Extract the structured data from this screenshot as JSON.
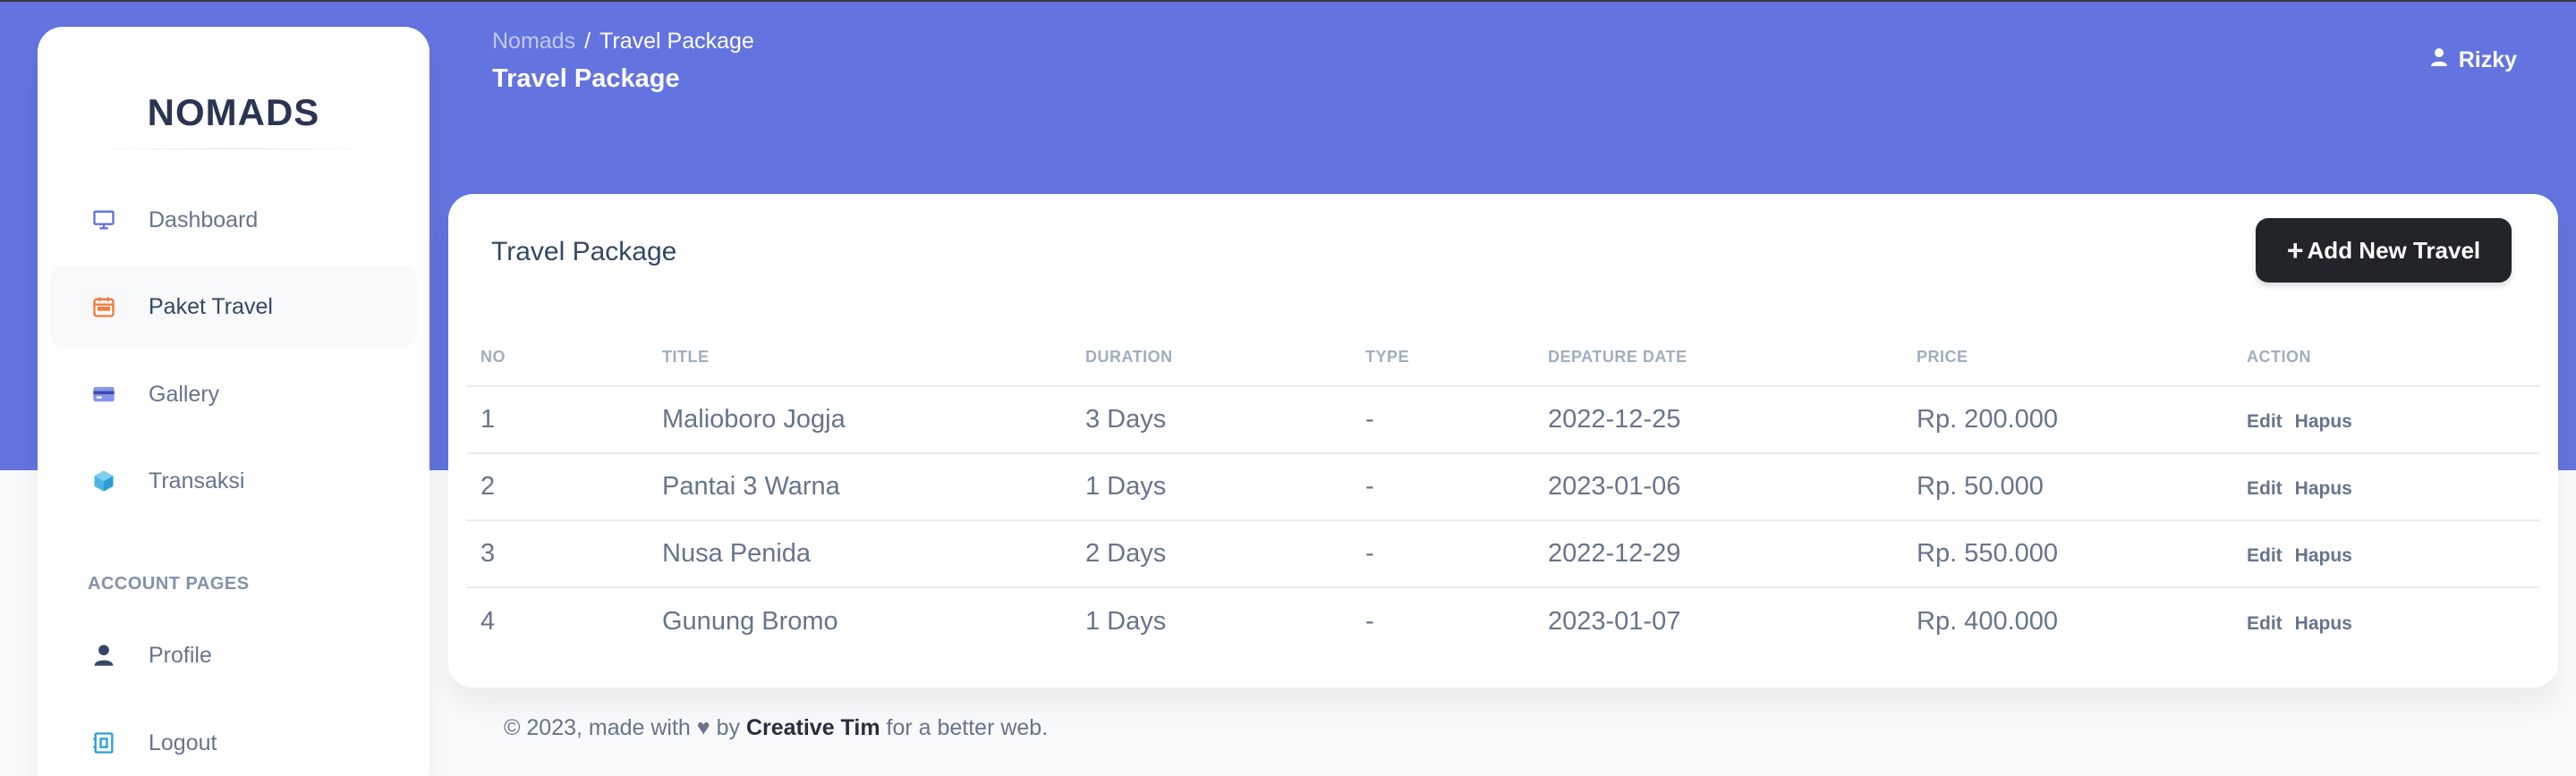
{
  "brand": {
    "name": "NOMADS"
  },
  "sidebar": {
    "items": [
      {
        "label": "Dashboard",
        "icon": "monitor-icon",
        "active": false
      },
      {
        "label": "Paket Travel",
        "icon": "calendar-icon",
        "active": true
      },
      {
        "label": "Gallery",
        "icon": "credit-card-icon",
        "active": false
      },
      {
        "label": "Transaksi",
        "icon": "box-icon",
        "active": false
      }
    ],
    "account_heading": "ACCOUNT PAGES",
    "account_items": [
      {
        "label": "Profile",
        "icon": "user-icon"
      },
      {
        "label": "Logout",
        "icon": "logout-icon"
      }
    ]
  },
  "header": {
    "breadcrumb_root": "Nomads",
    "breadcrumb_sep": "/",
    "breadcrumb_current": "Travel Package",
    "title": "Travel Package",
    "user_name": "Rizky"
  },
  "card": {
    "title": "Travel Package",
    "add_button": "Add New Travel"
  },
  "table": {
    "columns": [
      "NO",
      "TITLE",
      "DURATION",
      "TYPE",
      "DEPATURE DATE",
      "PRICE",
      "ACTION"
    ],
    "rows": [
      {
        "no": "1",
        "title": "Malioboro Jogja",
        "duration": "3 Days",
        "type": "-",
        "date": "2022-12-25",
        "price": "Rp. 200.000",
        "edit": "Edit",
        "delete": "Hapus"
      },
      {
        "no": "2",
        "title": "Pantai 3 Warna",
        "duration": "1 Days",
        "type": "-",
        "date": "2023-01-06",
        "price": "Rp. 50.000",
        "edit": "Edit",
        "delete": "Hapus"
      },
      {
        "no": "3",
        "title": "Nusa Penida",
        "duration": "2 Days",
        "type": "-",
        "date": "2022-12-29",
        "price": "Rp. 550.000",
        "edit": "Edit",
        "delete": "Hapus"
      },
      {
        "no": "4",
        "title": "Gunung Bromo",
        "duration": "1 Days",
        "type": "-",
        "date": "2023-01-07",
        "price": "Rp. 400.000",
        "edit": "Edit",
        "delete": "Hapus"
      }
    ]
  },
  "footer": {
    "prefix": "© 2023, made with",
    "by": "by",
    "author": "Creative Tim",
    "suffix": "for a better web."
  },
  "colors": {
    "header_bg": "#6373df",
    "accent_orange": "#f5793b",
    "dark_button": "#212529"
  }
}
